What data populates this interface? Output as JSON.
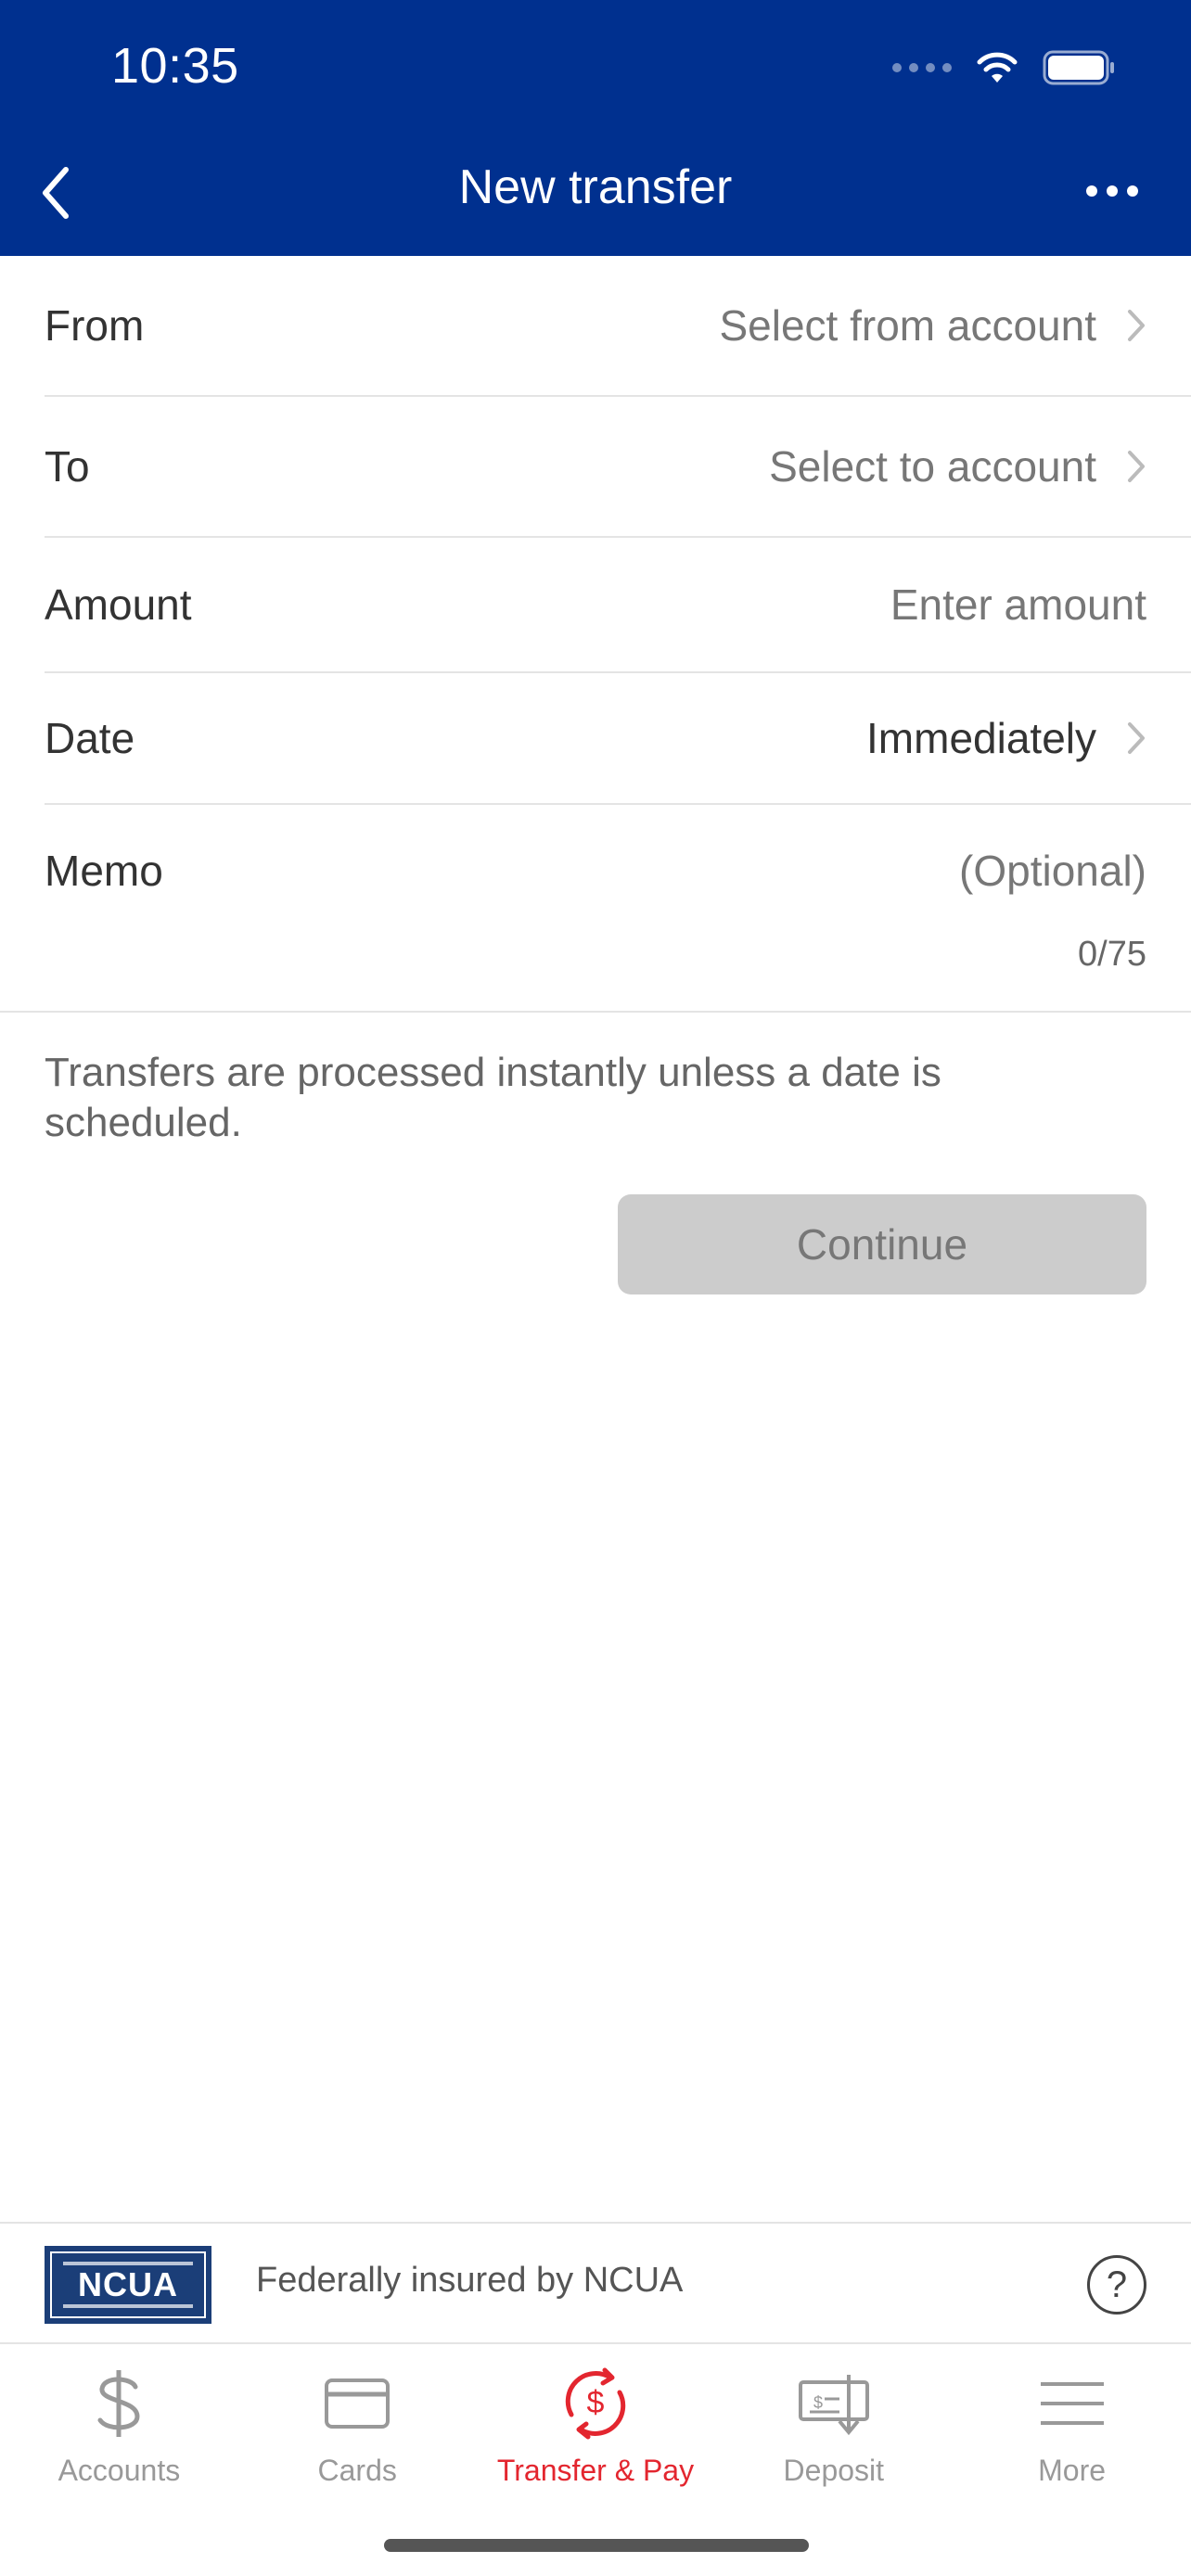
{
  "status_bar": {
    "time": "10:35"
  },
  "nav": {
    "title": "New transfer"
  },
  "form": {
    "from": {
      "label": "From",
      "value": "Select from account"
    },
    "to": {
      "label": "To",
      "value": "Select to account"
    },
    "amount": {
      "label": "Amount",
      "placeholder": "Enter amount"
    },
    "date": {
      "label": "Date",
      "value": "Immediately"
    },
    "memo": {
      "label": "Memo",
      "placeholder": "(Optional)",
      "counter": "0/75"
    }
  },
  "info_text": "Transfers are processed instantly unless a date is scheduled.",
  "continue_label": "Continue",
  "insurance": {
    "text": "Federally insured by NCUA",
    "logo_text": "NCUA"
  },
  "tabs": [
    {
      "label": "Accounts",
      "icon": "dollar-icon",
      "active": false
    },
    {
      "label": "Cards",
      "icon": "card-icon",
      "active": false
    },
    {
      "label": "Transfer & Pay",
      "icon": "transfer-pay-icon",
      "active": true
    },
    {
      "label": "Deposit",
      "icon": "deposit-check-icon",
      "active": false
    },
    {
      "label": "More",
      "icon": "menu-icon",
      "active": false
    }
  ],
  "colors": {
    "header": "#00308F",
    "active_tab": "#e3262f",
    "disabled_button": "#cccccc"
  }
}
